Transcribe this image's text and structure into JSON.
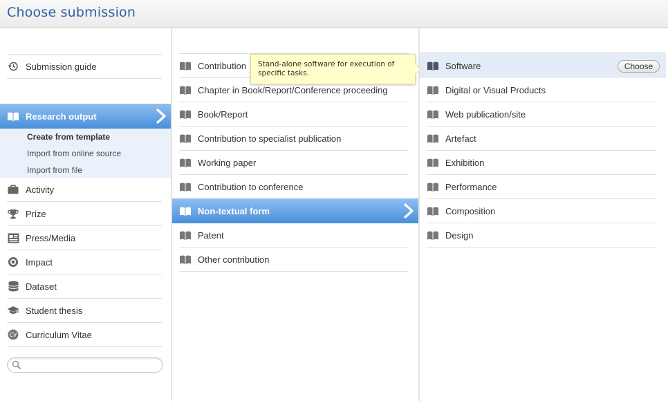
{
  "header": {
    "title": "Choose submission"
  },
  "col1": {
    "guide": {
      "label": "Submission guide",
      "icon": "history-icon"
    },
    "selected": {
      "label": "Research output",
      "icon": "book-icon"
    },
    "sub_items": [
      {
        "label": "Create from template"
      },
      {
        "label": "Import from online source"
      },
      {
        "label": "Import from file"
      }
    ],
    "items": [
      {
        "label": "Activity",
        "icon": "briefcase-icon"
      },
      {
        "label": "Prize",
        "icon": "trophy-icon"
      },
      {
        "label": "Press/Media",
        "icon": "newspaper-icon"
      },
      {
        "label": "Impact",
        "icon": "target-icon"
      },
      {
        "label": "Dataset",
        "icon": "database-icon"
      },
      {
        "label": "Student thesis",
        "icon": "graduation-cap-icon"
      },
      {
        "label": "Curriculum Vitae",
        "icon": "cv-icon"
      }
    ],
    "search": {
      "placeholder": ""
    }
  },
  "col2": {
    "items": [
      {
        "label": "Contribution"
      },
      {
        "label": "Chapter in Book/Report/Conference proceeding"
      },
      {
        "label": "Book/Report"
      },
      {
        "label": "Contribution to specialist publication"
      },
      {
        "label": "Working paper"
      },
      {
        "label": "Contribution to conference"
      },
      {
        "label": "Non-textual form"
      },
      {
        "label": "Patent"
      },
      {
        "label": "Other contribution"
      }
    ],
    "selected_label": "Non-textual form"
  },
  "tooltip": {
    "text": "Stand-alone software for execution of specific tasks."
  },
  "col3": {
    "items": [
      {
        "label": "Software"
      },
      {
        "label": "Digital or Visual Products"
      },
      {
        "label": "Web publication/site"
      },
      {
        "label": "Artefact"
      },
      {
        "label": "Exhibition"
      },
      {
        "label": "Performance"
      },
      {
        "label": "Composition"
      },
      {
        "label": "Design"
      }
    ],
    "choose_label": "Choose"
  },
  "colors": {
    "accent": "#4a8fdb",
    "title": "#2a62a6",
    "tooltip_bg": "#ffffcb"
  }
}
